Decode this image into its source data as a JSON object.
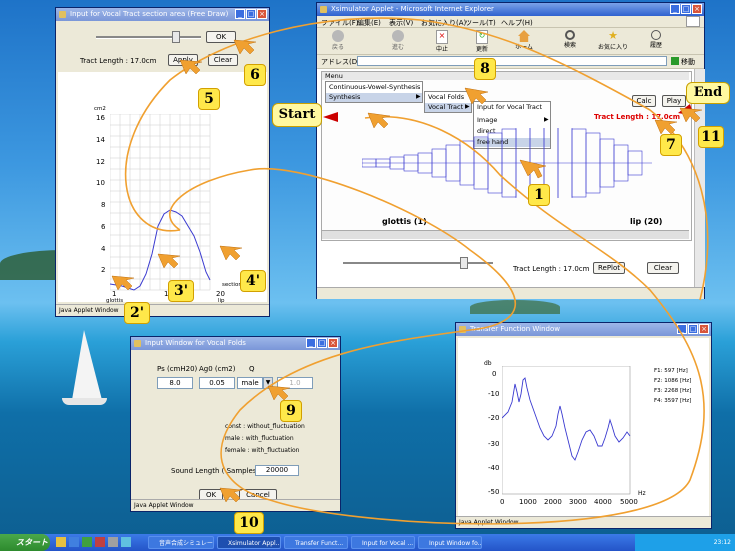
{
  "colors": {
    "annotation_curve": "#f0a030",
    "arrow": "#cc0000",
    "graph_line": "#3a3ad0"
  },
  "desktop": {
    "icon_name": "sailboat-ocean-wallpaper"
  },
  "browser": {
    "title": "Xsimulator Applet - Microsoft Internet Explorer",
    "menu": [
      "ファイル(F)",
      "編集(E)",
      "表示(V)",
      "お気に入り(A)",
      "ツール(T)",
      "ヘルプ(H)"
    ],
    "toolbar": [
      "戻る",
      "進む",
      "中止",
      "更新",
      "ホーム",
      "検索",
      "お気に入り",
      "履歴"
    ],
    "address_label": "アドレス(D)",
    "go_label": "移動"
  },
  "applet": {
    "menu_tab": "Menu",
    "menu_items": [
      "Continuous-Vowel-Synthesis",
      "Synthesis"
    ],
    "submenu1": [
      "Vocal Folds",
      "Vocal Tract"
    ],
    "submenu2": [
      "Input for Vocal Tract",
      "Image",
      "direct",
      "free hand"
    ],
    "calc": "Calc",
    "play": "Play",
    "tract_length_red": "Tract Length : 17.0cm",
    "glottis_label": "glottis (1)",
    "lip_label": "lip (20)",
    "tract_length": "Tract Length : 17.0cm",
    "replot": "RePlot",
    "clear": "Clear"
  },
  "area_window": {
    "title": "Input for Vocal Tract section area (Free Draw)",
    "ok": "OK",
    "tract_length": "Tract Length : 17.0cm",
    "apply": "Apply",
    "clear": "Clear",
    "y_unit": "cm2",
    "y_ticks": [
      "16",
      "14",
      "12",
      "10",
      "8",
      "6",
      "4",
      "2"
    ],
    "x_ticks": [
      "1",
      "10",
      "20"
    ],
    "x_left": "glottis",
    "x_right": "lip",
    "x_section": "section",
    "status": "Java Applet Window"
  },
  "vocal_window": {
    "title": "Input Window for Vocal Folds",
    "ps_label": "Ps (cmH20)",
    "ag_label": "Ag0 (cm2)",
    "q_label": "Q",
    "ps_value": "8.0",
    "ag_value": "0.05",
    "q_value": "male",
    "q_extra": "1.0",
    "legend": [
      "const : without_fluctuation",
      "male : with_fluctuation",
      "female : with_fluctuation"
    ],
    "sound_length_label": "Sound Length ( Samples )",
    "sound_length_value": "20000",
    "ok": "OK",
    "cancel": "Cancel",
    "status": "Java Applet Window"
  },
  "transfer_window": {
    "title": "Transfer Function Window",
    "y_unit": "db",
    "y_ticks": [
      "0",
      "-10",
      "-20",
      "-30",
      "-40",
      "-50"
    ],
    "x_ticks": [
      "0",
      "1000",
      "2000",
      "3000",
      "4000",
      "5000"
    ],
    "x_unit": "Hz",
    "formants": [
      "F1: 597 [Hz]",
      "F2: 1086 [Hz]",
      "F3: 2268 [Hz]",
      "F4: 3597 [Hz]"
    ],
    "status": "Java Applet Window"
  },
  "taskbar": {
    "start": "スタート",
    "tasks": [
      "音声合成シミュレータ...",
      "Xsimulator Appl...",
      "Transfer Funct...",
      "Input for Vocal ...",
      "Input Window fo..."
    ],
    "clock": "23:12"
  },
  "annotations": {
    "start": "Start",
    "end": "End",
    "steps": [
      "1",
      "2'",
      "3'",
      "4'",
      "5",
      "6",
      "7",
      "8",
      "9",
      "10",
      "11"
    ]
  }
}
